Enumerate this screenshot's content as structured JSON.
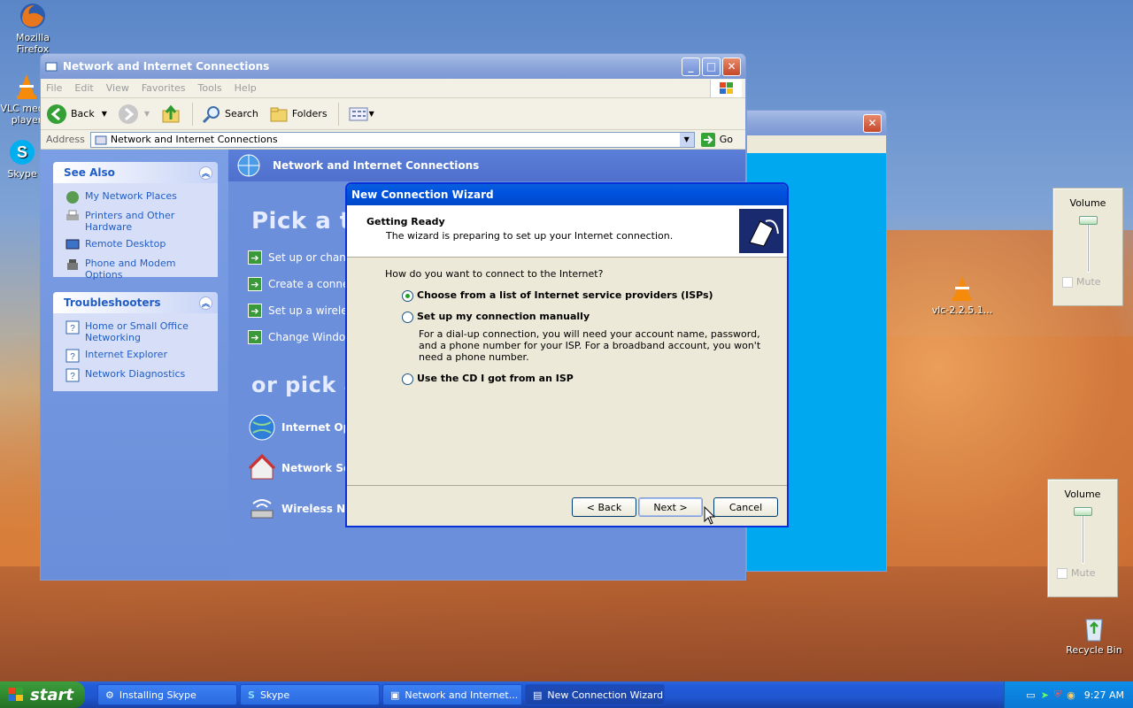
{
  "desktop": {
    "icons": [
      {
        "label": "Mozilla Firefox"
      },
      {
        "label": "VLC media player"
      },
      {
        "label": "Skype"
      },
      {
        "label": "vlc-2.2.5.1..."
      },
      {
        "label": "Recycle Bin"
      }
    ]
  },
  "explorer": {
    "title": "Network and Internet Connections",
    "menu": [
      "File",
      "Edit",
      "View",
      "Favorites",
      "Tools",
      "Help"
    ],
    "toolbar": {
      "back": "Back",
      "search": "Search",
      "folders": "Folders"
    },
    "address_label": "Address",
    "address_value": "Network and Internet Connections",
    "go": "Go",
    "see_also": {
      "title": "See Also",
      "items": [
        "My Network Places",
        "Printers and Other Hardware",
        "Remote Desktop",
        "Phone and Modem Options"
      ]
    },
    "troubleshooters": {
      "title": "Troubleshooters",
      "items": [
        "Home or Small Office Networking",
        "Internet Explorer",
        "Network Diagnostics"
      ]
    },
    "main_header": "Network and Internet Connections",
    "pick_task": "Pick a ta",
    "tasks": [
      "Set up or chang",
      "Create a conne",
      "Set up a wirele",
      "Change Window"
    ],
    "pick_icon": "or pick a",
    "cp_icons": [
      "Internet Opt",
      "Network Sett",
      "Wireless Netw"
    ]
  },
  "wizard": {
    "title": "New Connection Wizard",
    "heading": "Getting Ready",
    "subheading": "The wizard is preparing to set up your Internet connection.",
    "question": "How do you want to connect to the Internet?",
    "options": [
      {
        "label": "Choose from a list of Internet service providers (ISPs)",
        "selected": true
      },
      {
        "label": "Set up my connection manually",
        "selected": false,
        "description": "For a dial-up connection, you will need your account name, password, and a phone number for your ISP. For a broadband account, you won't need a phone number."
      },
      {
        "label": "Use the CD I got from an ISP",
        "selected": false
      }
    ],
    "buttons": {
      "back": "< Back",
      "next": "Next >",
      "cancel": "Cancel"
    }
  },
  "volume": [
    {
      "title": "Volume",
      "mute": "Mute"
    },
    {
      "title": "Volume",
      "mute": "Mute"
    }
  ],
  "taskbar": {
    "start": "start",
    "buttons": [
      "Installing Skype",
      "Skype",
      "Network and Internet...",
      "New Connection Wizard"
    ],
    "clock": "9:27 AM"
  }
}
